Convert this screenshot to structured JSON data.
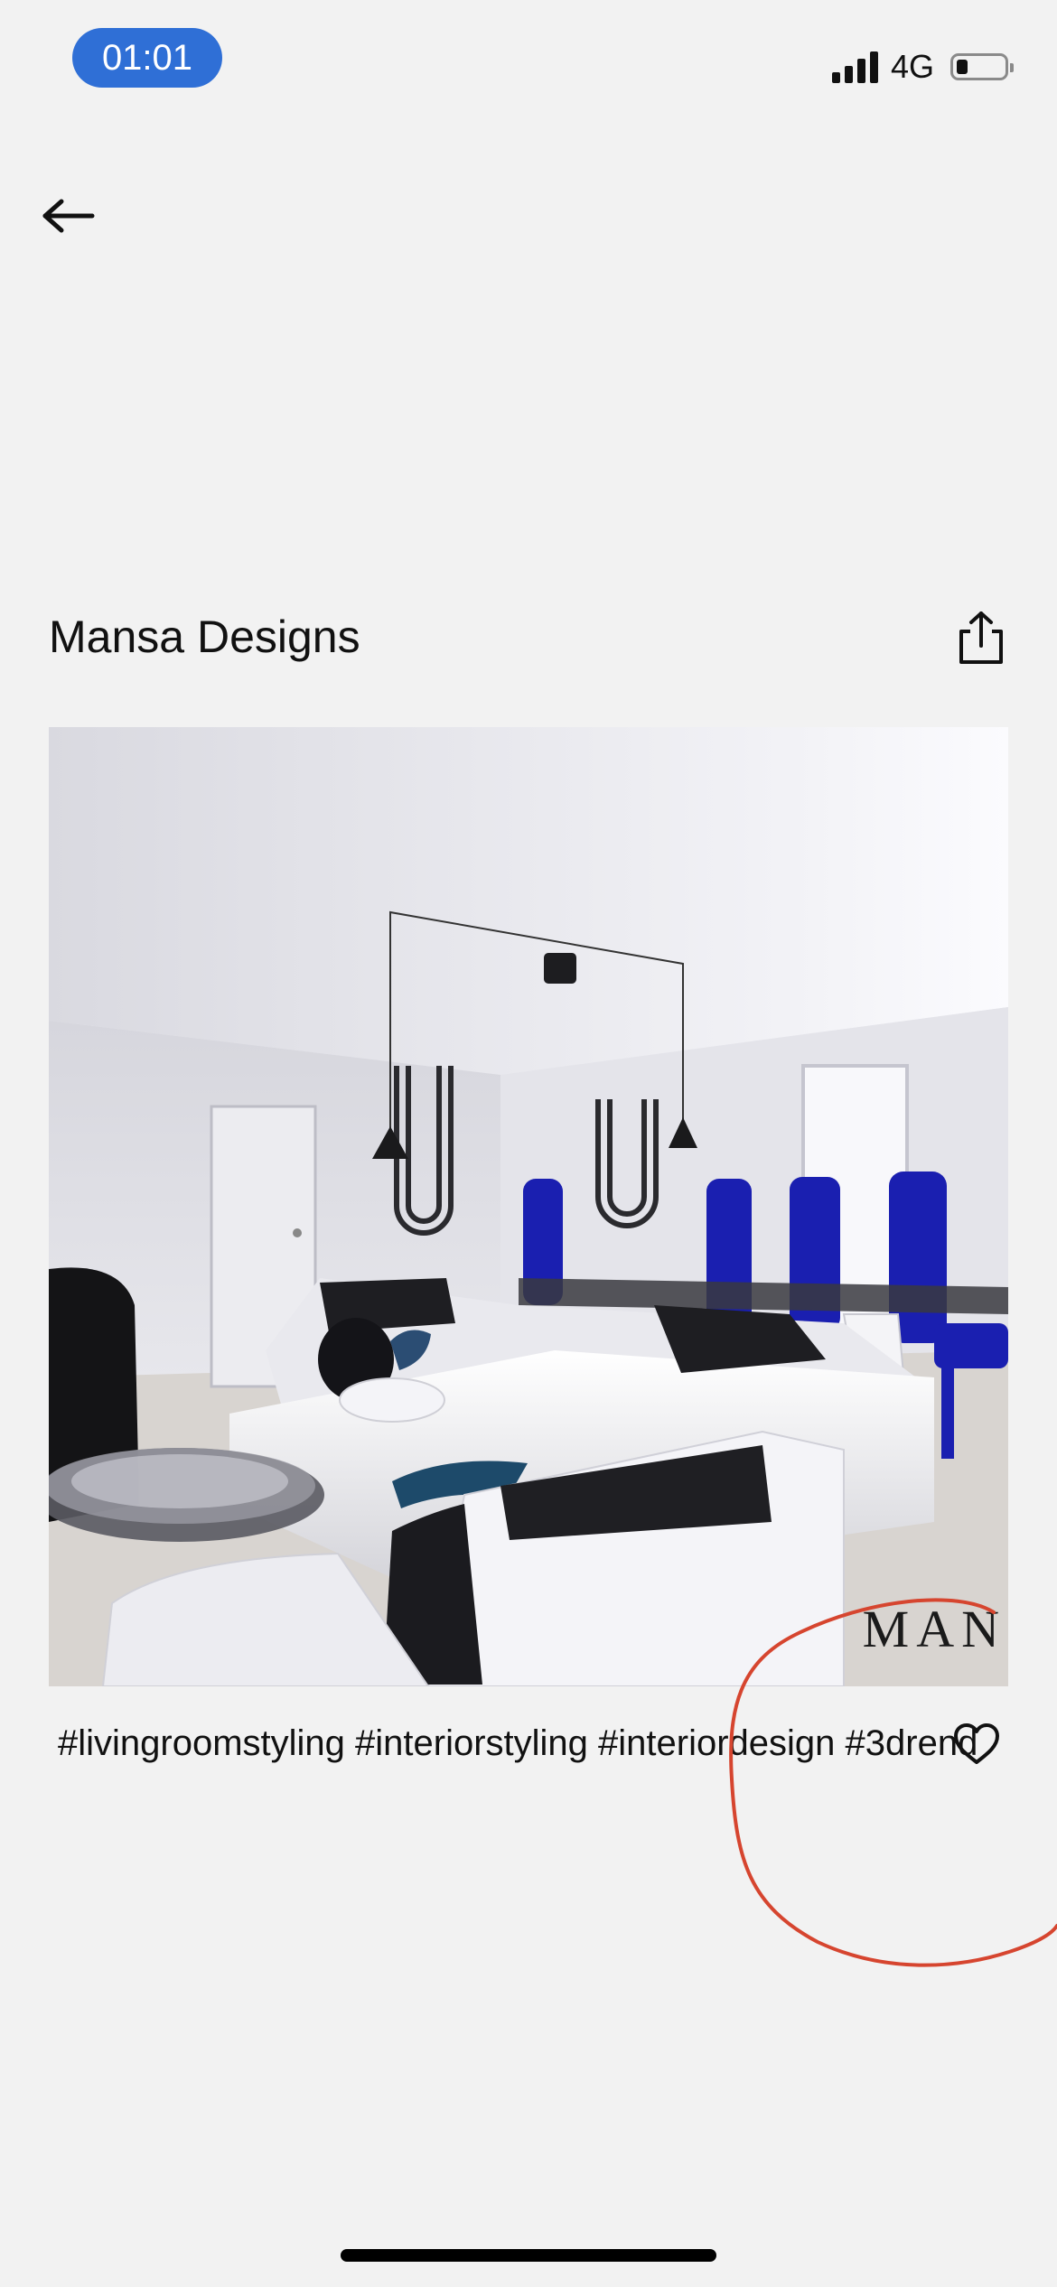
{
  "status_bar": {
    "time": "01:01",
    "network": "4G",
    "battery_level": 0.2
  },
  "header": {
    "back_icon": "arrow-left-icon",
    "title": "Mansa Designs",
    "share_icon": "share-icon"
  },
  "post": {
    "image_watermark": "MAN",
    "caption": "#livingroomstyling #interiorstyling #interiordesign #3drend",
    "like_icon": "heart-outline-icon"
  },
  "annotation": {
    "color": "#d6452f"
  },
  "colors": {
    "accent": "#2f6fd6",
    "background": "#f2f2f2"
  }
}
